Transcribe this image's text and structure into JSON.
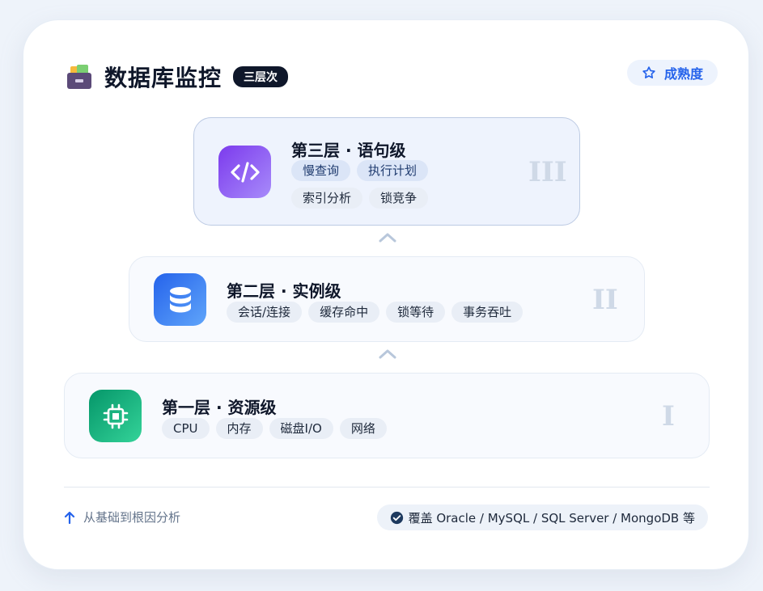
{
  "header": {
    "title": "数据库监控",
    "badge": "三层次",
    "maturity_label": "成熟度"
  },
  "layers": [
    {
      "name": "第三层 · 语句级",
      "roman": "III",
      "icon": "code-icon",
      "tags": [
        "慢查询",
        "执行计划",
        "索引分析",
        "锁竞争"
      ]
    },
    {
      "name": "第二层 · 实例级",
      "roman": "II",
      "icon": "database-icon",
      "tags": [
        "会话/连接",
        "缓存命中",
        "锁等待",
        "事务吞吐"
      ]
    },
    {
      "name": "第一层 · 资源级",
      "roman": "I",
      "icon": "cpu-chip-icon",
      "tags": [
        "CPU",
        "内存",
        "磁盘I/O",
        "网络"
      ]
    }
  ],
  "footer": {
    "direction_text": "从基础到根因分析",
    "coverage_text": "覆盖 Oracle / MySQL / SQL Server / MongoDB 等"
  },
  "colors": {
    "accent": "#2563eb",
    "badge_bg": "#0f172a",
    "layer3_gradient": [
      "#7c3aed",
      "#a78bfa"
    ],
    "layer2_gradient": [
      "#2563eb",
      "#60a5fa"
    ],
    "layer1_gradient": [
      "#059669",
      "#34d399"
    ]
  }
}
